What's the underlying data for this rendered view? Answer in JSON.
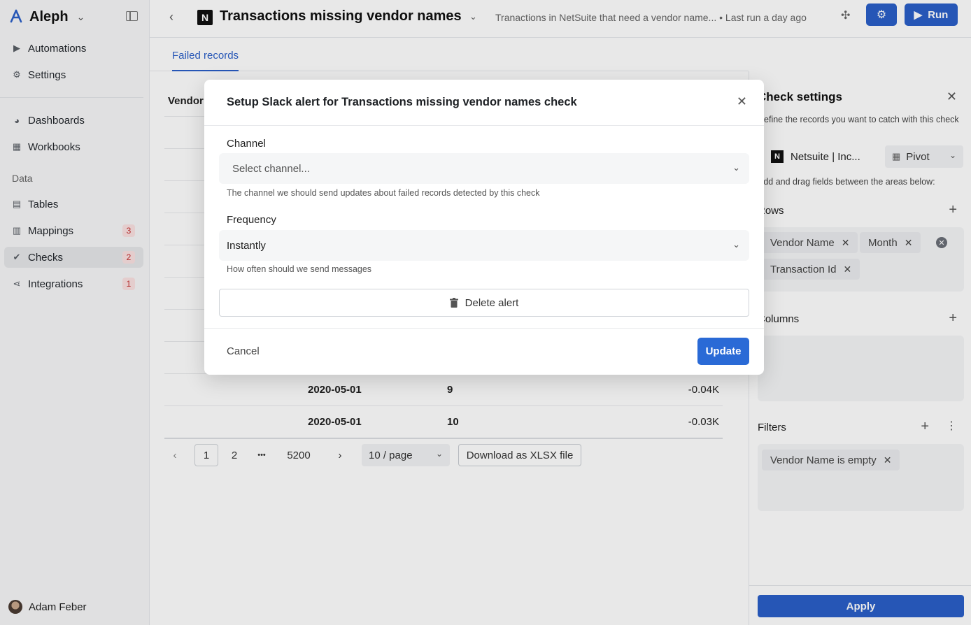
{
  "app": {
    "name": "Aleph"
  },
  "sidebar": {
    "items": [
      {
        "label": "Automations"
      },
      {
        "label": "Settings"
      },
      {
        "label": "Dashboards"
      },
      {
        "label": "Workbooks"
      },
      {
        "label": "Tables"
      },
      {
        "label": "Mappings",
        "badge": "3"
      },
      {
        "label": "Checks",
        "badge": "2"
      },
      {
        "label": "Integrations",
        "badge": "1"
      }
    ],
    "section_data": "Data",
    "user": "Adam Feber"
  },
  "header": {
    "title": "Transactions missing vendor names",
    "description": "Tranactions in NetSuite that need a vendor name...",
    "last_run": "• Last run a day ago",
    "run_label": "Run"
  },
  "tabs": [
    {
      "label": "Failed records"
    }
  ],
  "table": {
    "column_header": "Vendor",
    "rows": [
      {
        "date": "2020-05-01",
        "id": "9",
        "amount": "-0.04K"
      },
      {
        "date": "2020-05-01",
        "id": "10",
        "amount": "-0.03K"
      }
    ],
    "pager": {
      "pages": [
        "1",
        "2",
        "•••",
        "5200"
      ],
      "per_page": "10 / page",
      "download_label": "Download as XLSX file"
    }
  },
  "check_settings": {
    "title": "Check settings",
    "description": "Define the records you want to catch with this check",
    "source": "Netsuite | Inc...",
    "view": "Pivot",
    "hint": "Add and drag fields between the areas below:",
    "rows_label": "Rows",
    "row_fields": [
      "Vendor Name",
      "Month",
      "Transaction Id"
    ],
    "columns_label": "Columns",
    "filters_label": "Filters",
    "filters": [
      "Vendor Name is empty"
    ],
    "apply_label": "Apply"
  },
  "modal": {
    "title": "Setup Slack alert for Transactions missing vendor names check",
    "channel_label": "Channel",
    "channel_placeholder": "Select channel...",
    "channel_help": "The channel we should send updates about failed records detected by this check",
    "frequency_label": "Frequency",
    "frequency_value": "Instantly",
    "frequency_help": "How often should we send messages",
    "delete_label": "Delete alert",
    "cancel_label": "Cancel",
    "update_label": "Update"
  },
  "colors": {
    "accent": "#2a5fc9",
    "badge_bg": "#fbe2e2",
    "badge_text": "#c53030"
  }
}
